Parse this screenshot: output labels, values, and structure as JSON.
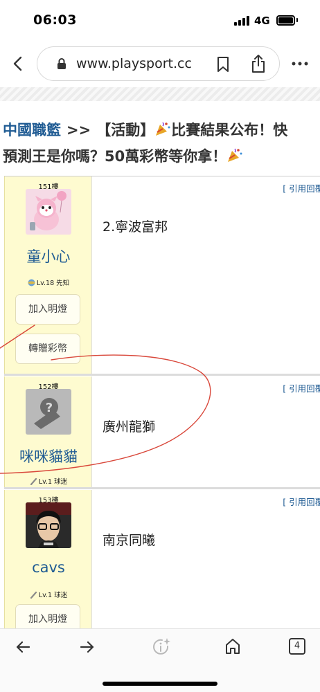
{
  "status_bar": {
    "time": "06:03",
    "network": "4G"
  },
  "browser": {
    "url": "www.playsport.cc"
  },
  "thread": {
    "board": "中國職籃",
    "separator": ">>",
    "title_line1": "【活動】",
    "title_line1_rest": "比賽結果公布！快",
    "title_line2": "預測王是你嗎？50萬彩幣等你拿！"
  },
  "posts": [
    {
      "floor": "151樓",
      "username": "童小心",
      "level": "Lv.18 先知",
      "content": "2.寧波富邦",
      "quote": "[ 引用回覆 ]",
      "buttons": [
        "加入明燈",
        "轉贈彩幣"
      ]
    },
    {
      "floor": "152樓",
      "username": "咪咪貓貓",
      "level": "Lv.1 球迷",
      "content": "廣州龍獅",
      "quote": "[ 引用回覆 ]",
      "buttons": []
    },
    {
      "floor": "153樓",
      "username": "cavs",
      "level": "Lv.1 球迷",
      "content": "南京同曦",
      "quote": "[ 引用回覆 ]",
      "buttons": [
        "加入明燈"
      ]
    }
  ],
  "toolbar": {
    "tab_count": "4"
  },
  "colors": {
    "link_blue": "#1f5b93",
    "sidebar_yellow": "#fefbd0",
    "annotation_red": "#d9483b"
  }
}
